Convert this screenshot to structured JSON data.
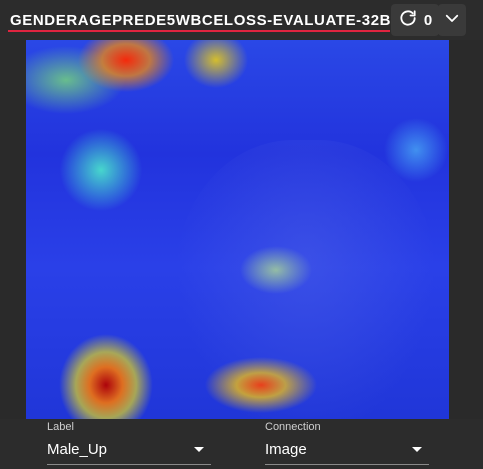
{
  "header": {
    "title": "GENDERAGEPREDE5WBCELOSS-EVALUATE-32B",
    "counter_value": "0"
  },
  "controls": {
    "label_field": {
      "label": "Label",
      "value": "Male_Up"
    },
    "connection_field": {
      "label": "Connection",
      "value": "Image"
    }
  },
  "colors": {
    "accent": "#e0243f",
    "background": "#2c2c2c"
  },
  "icons": {
    "refresh": "refresh-icon",
    "dropdown": "chevron-down-icon"
  }
}
